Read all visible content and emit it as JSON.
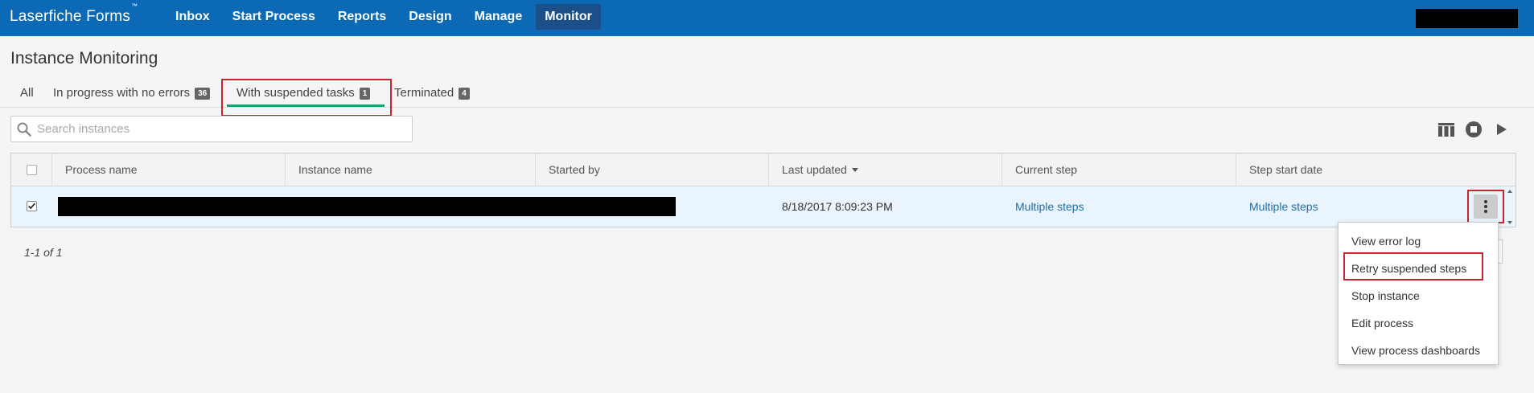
{
  "app": {
    "brand": "Laserfiche Forms",
    "trademark": "™"
  },
  "nav": {
    "items": [
      {
        "label": "Inbox"
      },
      {
        "label": "Start Process"
      },
      {
        "label": "Reports"
      },
      {
        "label": "Design"
      },
      {
        "label": "Manage"
      },
      {
        "label": "Monitor",
        "active": true
      }
    ]
  },
  "page": {
    "title": "Instance Monitoring"
  },
  "tabs": [
    {
      "label": "All",
      "count": ""
    },
    {
      "label": "In progress with no errors",
      "count": "36"
    },
    {
      "label": "With suspended tasks",
      "count": "1",
      "active": true
    },
    {
      "label": "Terminated",
      "count": "4"
    }
  ],
  "search": {
    "placeholder": "Search instances",
    "value": ""
  },
  "toolbar": {
    "icons": [
      "columns-icon",
      "stop-icon",
      "play-icon"
    ]
  },
  "table": {
    "columns": [
      "Process name",
      "Instance name",
      "Started by",
      "Last updated",
      "Current step",
      "Step start date"
    ],
    "sorted_column": "Last updated",
    "rows": [
      {
        "checked": true,
        "last_updated": "8/18/2017 8:09:23 PM",
        "current_step": "Multiple steps",
        "step_start_date": "Multiple steps"
      }
    ]
  },
  "pager": {
    "text": "1-1 of 1"
  },
  "context_menu": {
    "items": [
      {
        "label": "View error log"
      },
      {
        "label": "Retry suspended steps"
      },
      {
        "label": "Stop instance"
      },
      {
        "label": "Edit process"
      },
      {
        "label": "View process dashboards"
      }
    ]
  },
  "colors": {
    "topbar": "#0b69b6",
    "nav_active": "#1a4f8a",
    "tab_underline": "#1f9d73",
    "highlight": "#c9252c",
    "link": "#1f6fa8",
    "row_selected": "#eaf4fc"
  }
}
